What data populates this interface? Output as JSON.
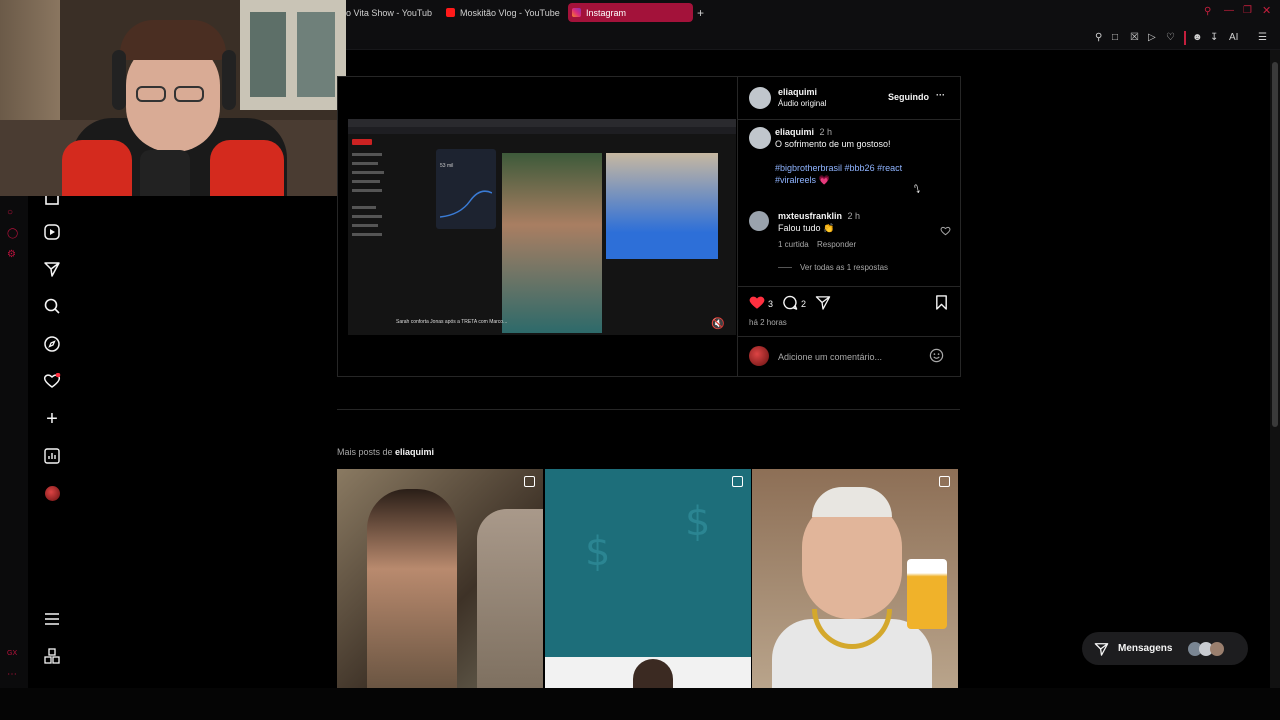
{
  "browser": {
    "tabs": [
      {
        "label": "o Vita Show - YouTub",
        "icon": "youtube-icon",
        "active": false
      },
      {
        "label": "Moskitão Vlog - YouTube",
        "icon": "youtube-icon",
        "active": false
      },
      {
        "label": "Instagram",
        "icon": "instagram-icon",
        "active": true
      }
    ],
    "new_tab_label": "+",
    "ai_label": "AI"
  },
  "post": {
    "author": "eliaquimi",
    "audio": "Áudio original",
    "follow_status": "Seguindo",
    "more": "···",
    "caption_author": "eliaquimi",
    "caption_time": "2 h",
    "caption_text": "O sofrimento de um gostoso!",
    "hashtags_line1": "#bigbrotherbrasil #bbb26 #react",
    "hashtags_line2": "#viralreels",
    "heart_emoji": "💗",
    "comment": {
      "author": "mxteusfranklin",
      "time": "2 h",
      "text": "Falou tudo 👏",
      "likes": "1 curtida",
      "reply": "Responder",
      "view_replies": "Ver todas as 1 respostas"
    },
    "like_count": "3",
    "comment_count": "2",
    "posted_ago": "há 2 horas",
    "comment_placeholder": "Adicione um comentário..."
  },
  "video_screen": {
    "headline": "Sarah conforta Jonas após a TRETA com Marco...",
    "stat_value": "53 mil"
  },
  "more_posts": {
    "prefix": "Mais posts de",
    "author": "eliaquimi"
  },
  "messages": {
    "label": "Mensagens"
  },
  "colors": {
    "accent": "#a3123a",
    "like": "#ff3040",
    "link": "#8fb4ff"
  }
}
